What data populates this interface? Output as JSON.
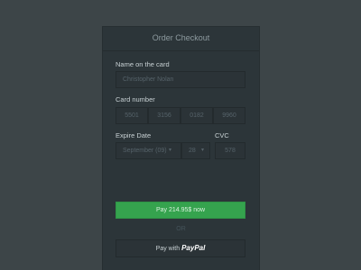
{
  "checkout": {
    "title": "Order Checkout",
    "name_label": "Name on the card",
    "name_value": "Christopher Nolan",
    "card_label": "Card number",
    "card_groups": [
      "5501",
      "3156",
      "0182",
      "9960"
    ],
    "expire_label": "Expire Date",
    "expire_month": "September (09)",
    "expire_day": "28",
    "cvc_label": "CVC",
    "cvc_value": "578",
    "pay_label": "Pay 214.95$ now",
    "or_label": "OR",
    "paypal_prefix": "Pay with",
    "paypal_brand": "PayPal"
  },
  "colors": {
    "background": "#3d4548",
    "panel": "#2c3539",
    "pay_button": "#35a34e",
    "text": "#c8d1d4",
    "muted_text": "#56636a"
  }
}
